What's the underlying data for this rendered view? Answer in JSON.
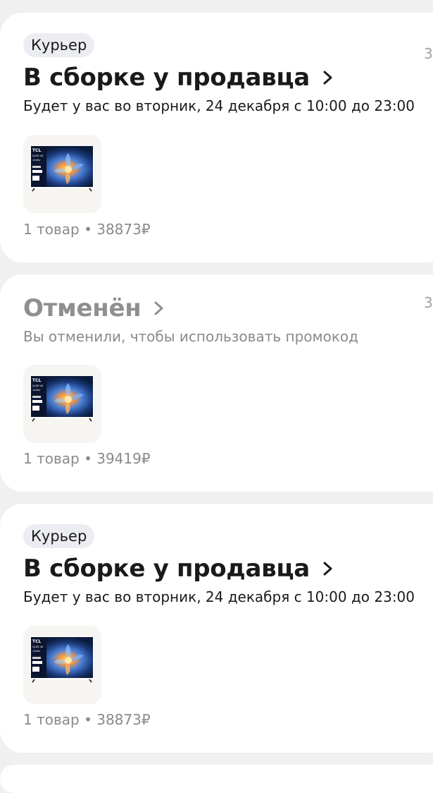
{
  "colors": {
    "page_bg": "#f0f0f0",
    "card_bg": "#ffffff",
    "badge_bg": "#ebedf2",
    "text_primary": "#1a1a1a",
    "text_muted": "#8a8a8a",
    "thumb_bg": "#f6f5f2"
  },
  "orders": [
    {
      "badge": "Курьер",
      "status": "В сборке у продавца",
      "status_style": "active",
      "details": "Будет у вас во вторник, 24 декабря с 10:00 до 23:00",
      "product_image": "tcl-qled-tv-thumbnail",
      "tv_brand": "TCL",
      "tv_line1": "QLED 4K",
      "tv_line2": "144Hz",
      "summary": "1 товар • 38873₽",
      "edge_digit": "3",
      "chevron_icon": "chevron-right-icon"
    },
    {
      "badge": "",
      "status": "Отменён",
      "status_style": "muted",
      "details": "Вы отменили, чтобы использовать промокод",
      "product_image": "tcl-qled-tv-thumbnail",
      "tv_brand": "TCL",
      "tv_line1": "QLED 4K",
      "tv_line2": "144Hz",
      "summary": "1 товар • 39419₽",
      "edge_digit": "3",
      "chevron_icon": "chevron-right-icon"
    },
    {
      "badge": "Курьер",
      "status": "В сборке у продавца",
      "status_style": "active",
      "details": "Будет у вас во вторник, 24 декабря с 10:00 до 23:00",
      "product_image": "tcl-qled-tv-thumbnail",
      "tv_brand": "TCL",
      "tv_line1": "QLED 4K",
      "tv_line2": "144Hz",
      "summary": "1 товар • 38873₽",
      "edge_digit": "",
      "chevron_icon": "chevron-right-icon"
    }
  ]
}
